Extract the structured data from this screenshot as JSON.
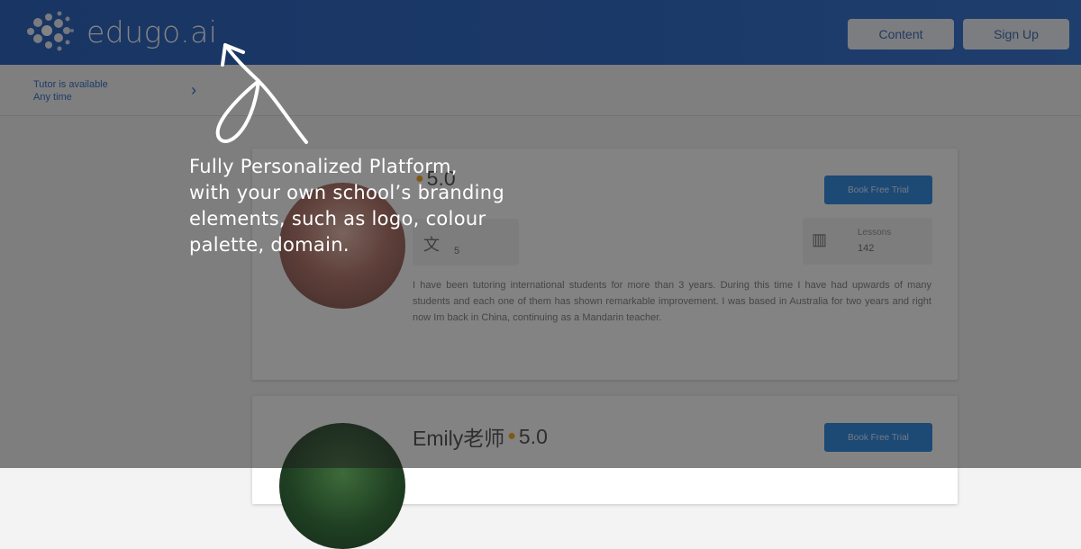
{
  "header": {
    "logo_text": "edugo.ai",
    "content_button": "Content",
    "signup_button": "Sign Up"
  },
  "filter": {
    "line1": "Tutor is available",
    "line2": "Any time",
    "chevron": "›"
  },
  "tutors": [
    {
      "name": "",
      "rating": "5.0",
      "book_button": "Book Free Trial",
      "stat1_value": "5",
      "stat2_label": "Lessons",
      "stat2_value": "142",
      "bio": "I have been tutoring international students for more than 3 years. During this time I have had upwards of many students and each one of them has shown remarkable improvement. I was based in Australia for two years and right now Im back in China, continuing as a Mandarin teacher."
    },
    {
      "name": "Emily老师",
      "rating": "5.0",
      "book_button": "Book Free Trial"
    }
  ],
  "annotation": {
    "lines": [
      "Fully Personalized Platform,",
      "with your own school’s branding",
      "elements, such as logo, colour",
      "palette, domain."
    ]
  },
  "colors": {
    "header_blue": "#1a5cc4",
    "accent_button": "#1e7fe0",
    "star": "#f2a20b"
  }
}
